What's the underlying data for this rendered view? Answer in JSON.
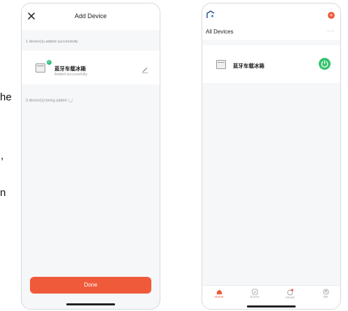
{
  "background_fragments": [
    "he",
    ",",
    "n"
  ],
  "left_screen": {
    "title": "Add Device",
    "added_status": "1 device(s) added successfully",
    "device": {
      "name": "蓝牙车载冰箱",
      "status": "Added successfully"
    },
    "adding_status": "0 device(s) being added",
    "done_label": "Done",
    "accent_color": "#ef5a3a"
  },
  "right_screen": {
    "header_title": "All Devices",
    "more_label": "···",
    "device": {
      "name": "蓝牙车载冰箱"
    },
    "tabs": [
      {
        "label": "Home",
        "icon": "home-icon",
        "active": true
      },
      {
        "label": "Scene",
        "icon": "scene-icon",
        "active": false
      },
      {
        "label": "Smart",
        "icon": "smart-icon",
        "active": false
      },
      {
        "label": "Me",
        "icon": "me-icon",
        "active": false
      }
    ],
    "power_color": "#36c36e"
  }
}
